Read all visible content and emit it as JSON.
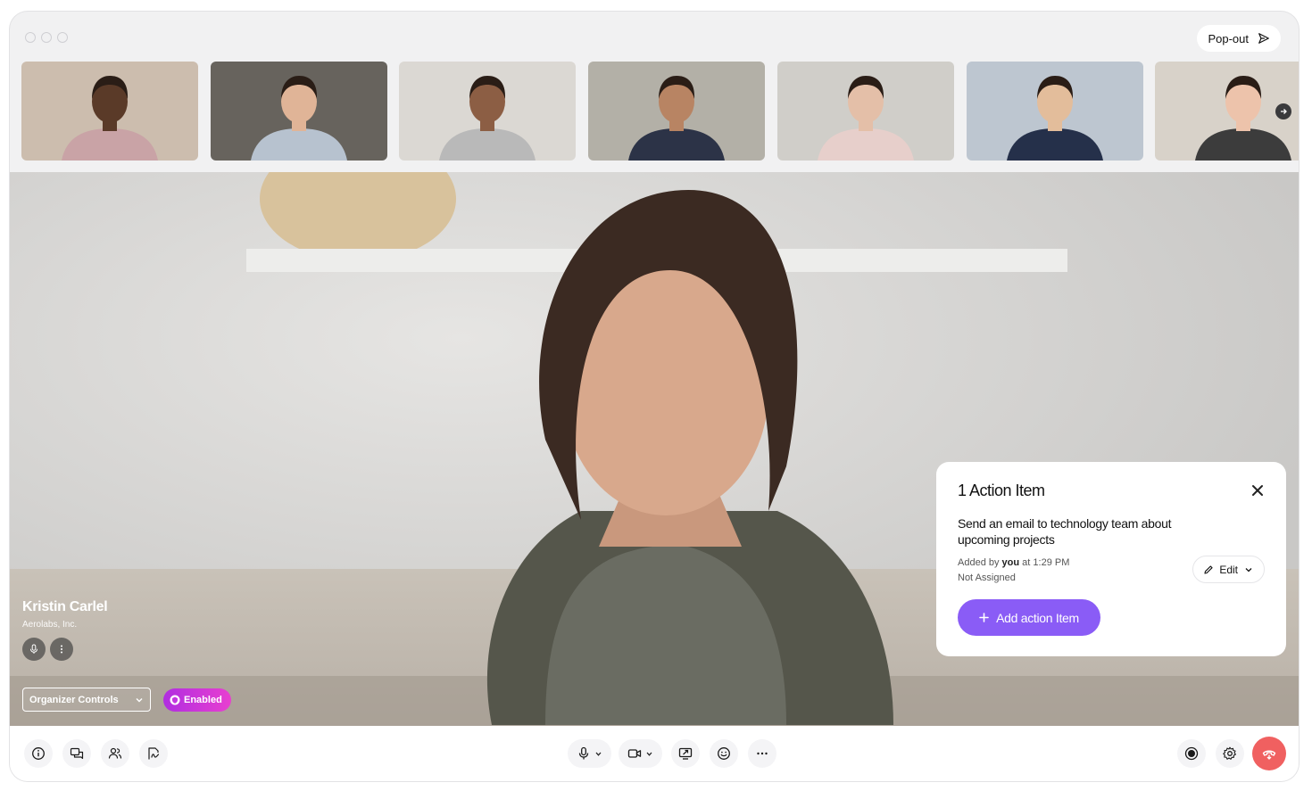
{
  "window": {
    "popout_label": "Pop-out"
  },
  "participants": [
    {
      "name": "participant-1",
      "bg": "#d9c9b9",
      "skin": "#5a3a28",
      "shirt": "#c9a3a6"
    },
    {
      "name": "participant-2",
      "bg": "#6e6a63",
      "skin": "#e0b497",
      "shirt": "#b7c2cf"
    },
    {
      "name": "participant-3",
      "bg": "#e9e6e1",
      "skin": "#8c5e44",
      "shirt": "#b9b9b9"
    },
    {
      "name": "participant-4",
      "bg": "#bfbbb2",
      "skin": "#b88463",
      "shirt": "#2c3347"
    },
    {
      "name": "participant-5",
      "bg": "#dedbd6",
      "skin": "#e4bfa8",
      "shirt": "#e7cfcb"
    },
    {
      "name": "participant-6",
      "bg": "#c9d3dd",
      "skin": "#e3bd9b",
      "shirt": "#25304a"
    },
    {
      "name": "participant-7",
      "bg": "#e6e0d6",
      "skin": "#edc3ab",
      "shirt": "#3c3c3c"
    }
  ],
  "speaker": {
    "name": "Kristin Carlel",
    "org": "Aerolabs, Inc."
  },
  "organizer": {
    "label": "Organizer Controls",
    "badge": "Enabled"
  },
  "action_card": {
    "title": "1 Action Item",
    "item_text": "Send an email to technology team about upcoming projects",
    "added_prefix": "Added by",
    "added_by": "you",
    "added_time": "at 1:29 PM",
    "assignee": "Not Assigned",
    "edit_label": "Edit",
    "add_label": "Add action Item"
  },
  "toolbar": {
    "left": [
      "info-icon",
      "chat-icon",
      "people-icon",
      "whiteboard-icon"
    ],
    "center": [
      "microphone-icon",
      "camera-icon",
      "screen-share-icon",
      "emoji-icon",
      "more-icon"
    ],
    "right": [
      "record-icon",
      "settings-icon",
      "hang-up-icon"
    ]
  },
  "colors": {
    "accent": "#8a5cf6",
    "hangup": "#f06060",
    "badge": "#c437e0"
  }
}
